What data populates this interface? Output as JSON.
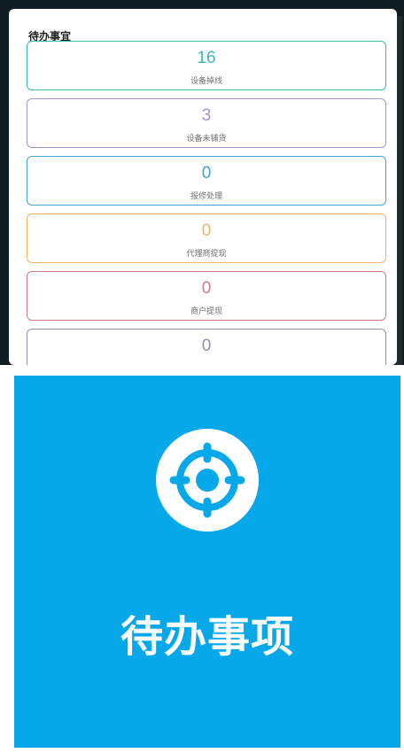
{
  "panel": {
    "title": "待办事宜",
    "cards": [
      {
        "value": "16",
        "label": "设备掉线",
        "color": "#3ab7b7"
      },
      {
        "value": "3",
        "label": "设备未铺货",
        "color": "#a593c8"
      },
      {
        "value": "0",
        "label": "报修处理",
        "color": "#3fa3d2"
      },
      {
        "value": "0",
        "label": "代理商提现",
        "color": "#efb36e"
      },
      {
        "value": "0",
        "label": "商户提现",
        "color": "#d07a88"
      },
      {
        "value": "0",
        "label": "",
        "color": "#8f8fb0"
      }
    ]
  },
  "banner": {
    "title": "待办事项",
    "background": "#07a8e9",
    "icon": "target-crosshair-icon"
  }
}
